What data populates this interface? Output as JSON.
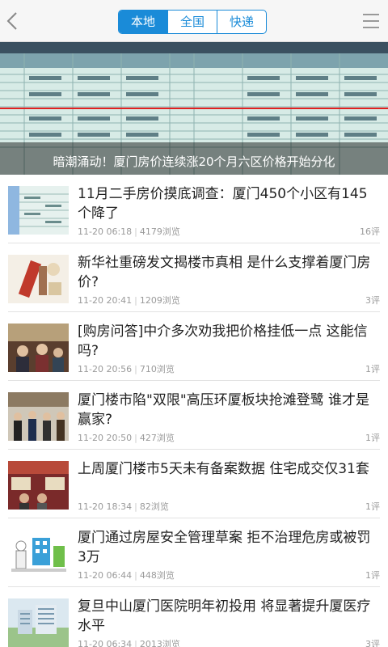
{
  "header": {
    "tabs": [
      {
        "label": "本地",
        "active": true
      },
      {
        "label": "全国",
        "active": false
      },
      {
        "label": "快递",
        "active": false
      }
    ],
    "accent_color": "#1a8bd8"
  },
  "banner": {
    "caption": "暗潮涌动！厦门房价连续涨20个月六区价格开始分化"
  },
  "items": [
    {
      "title": "11月二手房价摸底调查：厦门450个小区有145个降了",
      "time": "11-20 06:18",
      "views": "4179浏览",
      "comments": "16评"
    },
    {
      "title": "新华社重磅发文揭楼市真相 是什么支撑着厦门房价?",
      "time": "11-20 20:41",
      "views": "1209浏览",
      "comments": "3评"
    },
    {
      "title": "[购房问答]中介多次劝我把价格挂低一点 这能信吗?",
      "time": "11-20 20:56",
      "views": "710浏览",
      "comments": "1评"
    },
    {
      "title": "厦门楼市陷\"双限\"高压环厦板块抢滩登鹭 谁才是赢家?",
      "time": "11-20 20:50",
      "views": "427浏览",
      "comments": "1评"
    },
    {
      "title": "上周厦门楼市5天未有备案数据 住宅成交仅31套",
      "time": "11-20 18:34",
      "views": "82浏览",
      "comments": "1评"
    },
    {
      "title": "厦门通过房屋安全管理草案 拒不治理危房或被罚3万",
      "time": "11-20 06:44",
      "views": "448浏览",
      "comments": "1评"
    },
    {
      "title": "复旦中山厦门医院明年初投用 将显著提升厦医疗水平",
      "time": "11-20 06:34",
      "views": "2013浏览",
      "comments": "3评"
    }
  ]
}
